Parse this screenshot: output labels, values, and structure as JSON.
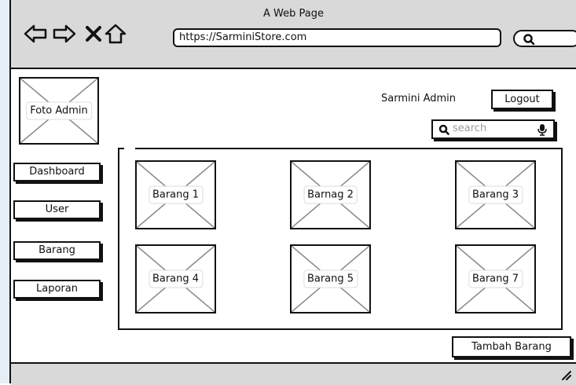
{
  "window": {
    "title": "A Web Page"
  },
  "toolbar": {
    "icons": [
      "back-arrow-icon",
      "forward-arrow-icon",
      "close-icon",
      "home-icon"
    ],
    "url": "https://SarminiStore.com",
    "search_icon": "search-icon"
  },
  "sidebar": {
    "photo_label": "Foto Admin",
    "items": [
      {
        "label": "Dashboard"
      },
      {
        "label": "User"
      },
      {
        "label": "Barang"
      },
      {
        "label": "Laporan"
      }
    ]
  },
  "header": {
    "user_name": "Sarmini Admin",
    "logout_label": "Logout",
    "search_placeholder": "search"
  },
  "products": [
    {
      "label": "Barang 1"
    },
    {
      "label": "Barnag 2"
    },
    {
      "label": "Barang 3"
    },
    {
      "label": "Barang 4"
    },
    {
      "label": "Barang 5"
    },
    {
      "label": "Barang 7"
    }
  ],
  "actions": {
    "add_label": "Tambah Barang"
  },
  "colors": {
    "chrome": "#d9d9d9",
    "ink": "#111111",
    "placeholder": "#9a9a9a"
  }
}
